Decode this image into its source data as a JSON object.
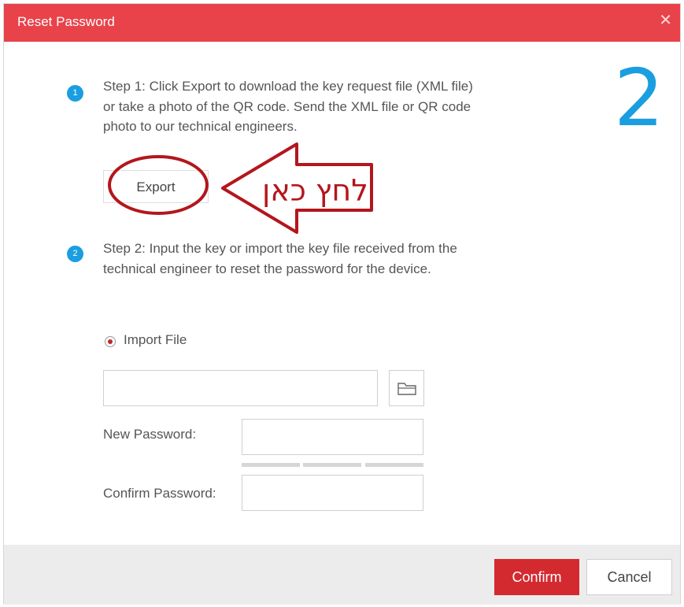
{
  "dialog": {
    "title": "Reset Password",
    "close_icon": "close-icon",
    "big_step_number": "2"
  },
  "step1": {
    "number": "1",
    "text": "Step 1: Click Export to download the key request file (XML file) or take a photo of the QR code. Send the XML file or QR code photo to our technical engineers.",
    "export_label": "Export"
  },
  "annotation": {
    "text": "לחץ כאן",
    "color": "#b3161c"
  },
  "step2": {
    "number": "2",
    "text": "Step 2: Input the key or import the key file received from the technical engineer to reset the password for the device.",
    "import_option_label": "Import File",
    "import_file_value": "",
    "browse_icon": "folder-icon",
    "new_password_label": "New Password:",
    "new_password_value": "",
    "confirm_password_label": "Confirm Password:",
    "confirm_password_value": ""
  },
  "footer": {
    "confirm_label": "Confirm",
    "cancel_label": "Cancel"
  },
  "colors": {
    "titlebar": "#e8434a",
    "accent_blue": "#1a9ee0",
    "confirm_button": "#d32a30"
  }
}
